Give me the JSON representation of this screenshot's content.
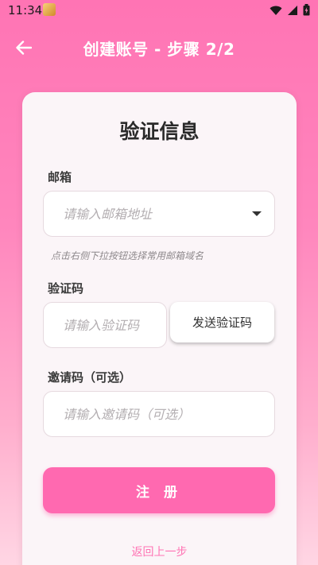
{
  "status_bar": {
    "time": "11:34"
  },
  "header": {
    "title": "创建账号 - 步骤 2/2"
  },
  "card": {
    "title": "验证信息",
    "email": {
      "label": "邮箱",
      "placeholder": "请输入邮箱地址",
      "hint": "点击右侧下拉按钮选择常用邮箱域名"
    },
    "code": {
      "label": "验证码",
      "placeholder": "请输入验证码",
      "send_label": "发送验证码"
    },
    "invite": {
      "label": "邀请码（可选）",
      "placeholder": "请输入邀请码（可选）"
    },
    "register_label": "注 册",
    "back_label": "返回上一步"
  },
  "colors": {
    "accent": "#ff69b0",
    "link": "#ff73b4",
    "card_bg": "#fbf5f8"
  }
}
